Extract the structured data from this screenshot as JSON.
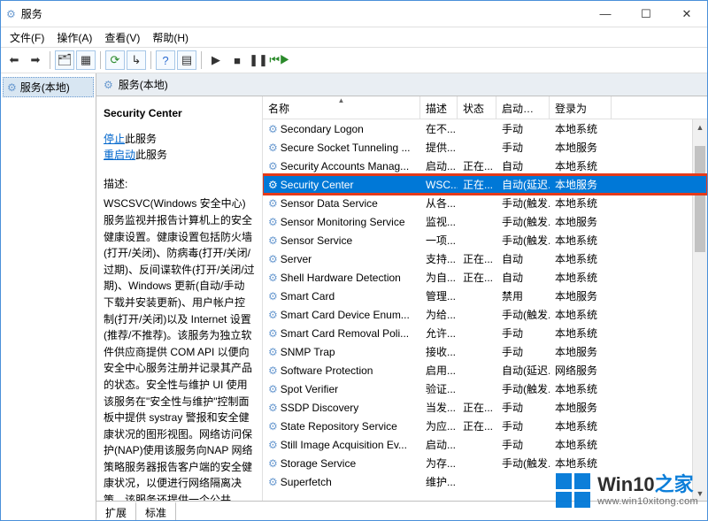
{
  "window": {
    "title": "服务",
    "controls": {
      "min": "—",
      "max": "☐",
      "close": "✕"
    }
  },
  "menubar": [
    {
      "label": "文件(F)"
    },
    {
      "label": "操作(A)"
    },
    {
      "label": "查看(V)"
    },
    {
      "label": "帮助(H)"
    }
  ],
  "toolbar": {
    "back_icon": "⬅",
    "forward_icon": "➡",
    "up_icon": "🗂",
    "console_icon": "▦",
    "refresh_icon": "⟳",
    "export_icon": "↳",
    "help_icon": "?",
    "properties_icon": "▤",
    "play_icon": "▶",
    "stop_icon": "■",
    "pause_icon": "❚❚",
    "restart_icon": "⏮▶"
  },
  "tree": {
    "root_label": "服务(本地)"
  },
  "main_header": {
    "title": "服务(本地)"
  },
  "detail": {
    "title": "Security Center",
    "stop_link": "停止",
    "stop_suffix": "此服务",
    "restart_link": "重启动",
    "restart_suffix": "此服务",
    "desc_label": "描述:",
    "description": "WSCSVC(Windows 安全中心)服务监视并报告计算机上的安全健康设置。健康设置包括防火墙(打开/关闭)、防病毒(打开/关闭/过期)、反间谍软件(打开/关闭/过期)、Windows 更新(自动/手动下载并安装更新)、用户帐户控制(打开/关闭)以及 Internet 设置(推荐/不推荐)。该服务为独立软件供应商提供 COM API 以便向安全中心服务注册并记录其产品的状态。安全性与维护 UI 使用该服务在\"安全性与维护\"控制面板中提供 systray 警报和安全健康状况的图形视图。网络访问保护(NAP)使用该服务向NAP 网络策略服务器报告客户端的安全健康状况，以便进行网络隔离决策。该服务还提供一个公共"
  },
  "columns": {
    "name": "名称",
    "desc": "描述",
    "status": "状态",
    "startup": "启动类型",
    "logon": "登录为"
  },
  "rows": [
    {
      "name": "Secondary Logon",
      "desc": "在不...",
      "status": "",
      "start": "手动",
      "logon": "本地系统"
    },
    {
      "name": "Secure Socket Tunneling ...",
      "desc": "提供...",
      "status": "",
      "start": "手动",
      "logon": "本地服务"
    },
    {
      "name": "Security Accounts Manag...",
      "desc": "启动...",
      "status": "正在...",
      "start": "自动",
      "logon": "本地系统"
    },
    {
      "name": "Security Center",
      "desc": "WSC...",
      "status": "正在...",
      "start": "自动(延迟...",
      "logon": "本地服务",
      "selected": true,
      "redbox": true
    },
    {
      "name": "Sensor Data Service",
      "desc": "从各...",
      "status": "",
      "start": "手动(触发...",
      "logon": "本地系统"
    },
    {
      "name": "Sensor Monitoring Service",
      "desc": "监视...",
      "status": "",
      "start": "手动(触发...",
      "logon": "本地服务"
    },
    {
      "name": "Sensor Service",
      "desc": "一项...",
      "status": "",
      "start": "手动(触发...",
      "logon": "本地系统"
    },
    {
      "name": "Server",
      "desc": "支持...",
      "status": "正在...",
      "start": "自动",
      "logon": "本地系统"
    },
    {
      "name": "Shell Hardware Detection",
      "desc": "为自...",
      "status": "正在...",
      "start": "自动",
      "logon": "本地系统"
    },
    {
      "name": "Smart Card",
      "desc": "管理...",
      "status": "",
      "start": "禁用",
      "logon": "本地服务"
    },
    {
      "name": "Smart Card Device Enum...",
      "desc": "为给...",
      "status": "",
      "start": "手动(触发...",
      "logon": "本地系统"
    },
    {
      "name": "Smart Card Removal Poli...",
      "desc": "允许...",
      "status": "",
      "start": "手动",
      "logon": "本地系统"
    },
    {
      "name": "SNMP Trap",
      "desc": "接收...",
      "status": "",
      "start": "手动",
      "logon": "本地服务"
    },
    {
      "name": "Software Protection",
      "desc": "启用...",
      "status": "",
      "start": "自动(延迟...",
      "logon": "网络服务"
    },
    {
      "name": "Spot Verifier",
      "desc": "验证...",
      "status": "",
      "start": "手动(触发...",
      "logon": "本地系统"
    },
    {
      "name": "SSDP Discovery",
      "desc": "当发...",
      "status": "正在...",
      "start": "手动",
      "logon": "本地服务"
    },
    {
      "name": "State Repository Service",
      "desc": "为应...",
      "status": "正在...",
      "start": "手动",
      "logon": "本地系统"
    },
    {
      "name": "Still Image Acquisition Ev...",
      "desc": "启动...",
      "status": "",
      "start": "手动",
      "logon": "本地系统"
    },
    {
      "name": "Storage Service",
      "desc": "为存...",
      "status": "",
      "start": "手动(触发...",
      "logon": "本地系统"
    },
    {
      "name": "Superfetch",
      "desc": "维护...",
      "status": "",
      "start": "",
      "logon": ""
    }
  ],
  "tabs": {
    "extended": "扩展",
    "standard": "标准"
  },
  "watermark": {
    "brand_1": "Win10",
    "brand_2": "之家",
    "url": "www.win10xitong.com"
  }
}
